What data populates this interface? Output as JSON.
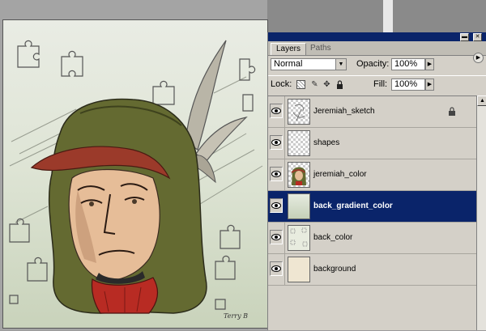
{
  "palette": {
    "tabs": [
      {
        "label": "Layers",
        "active": true
      },
      {
        "label": "Paths",
        "active": false
      }
    ],
    "blend_mode": "Normal",
    "opacity_label": "Opacity:",
    "opacity_value": "100%",
    "lock_label": "Lock:",
    "fill_label": "Fill:",
    "fill_value": "100%",
    "selection_color": "#0a246a"
  },
  "layers": [
    {
      "name": "Jeremiah_sketch",
      "visible": true,
      "locked": true,
      "thumbnail": "sketch"
    },
    {
      "name": "shapes",
      "visible": true,
      "locked": false,
      "thumbnail": "transparent"
    },
    {
      "name": "jeremiah_color",
      "visible": true,
      "locked": false,
      "thumbnail": "portrait"
    },
    {
      "name": "back_gradient_color",
      "visible": true,
      "locked": false,
      "thumbnail": "gradient",
      "selected": true
    },
    {
      "name": "back_color",
      "visible": true,
      "locked": false,
      "thumbnail": "shapes-dotted"
    },
    {
      "name": "background",
      "visible": true,
      "locked": false,
      "thumbnail": "solid-cream"
    }
  ],
  "icons": {
    "visibility": "eye-icon",
    "lock": "lock-icon",
    "palette_menu": "triangle-menu-icon"
  },
  "canvas": {
    "signature": "Terry B"
  }
}
